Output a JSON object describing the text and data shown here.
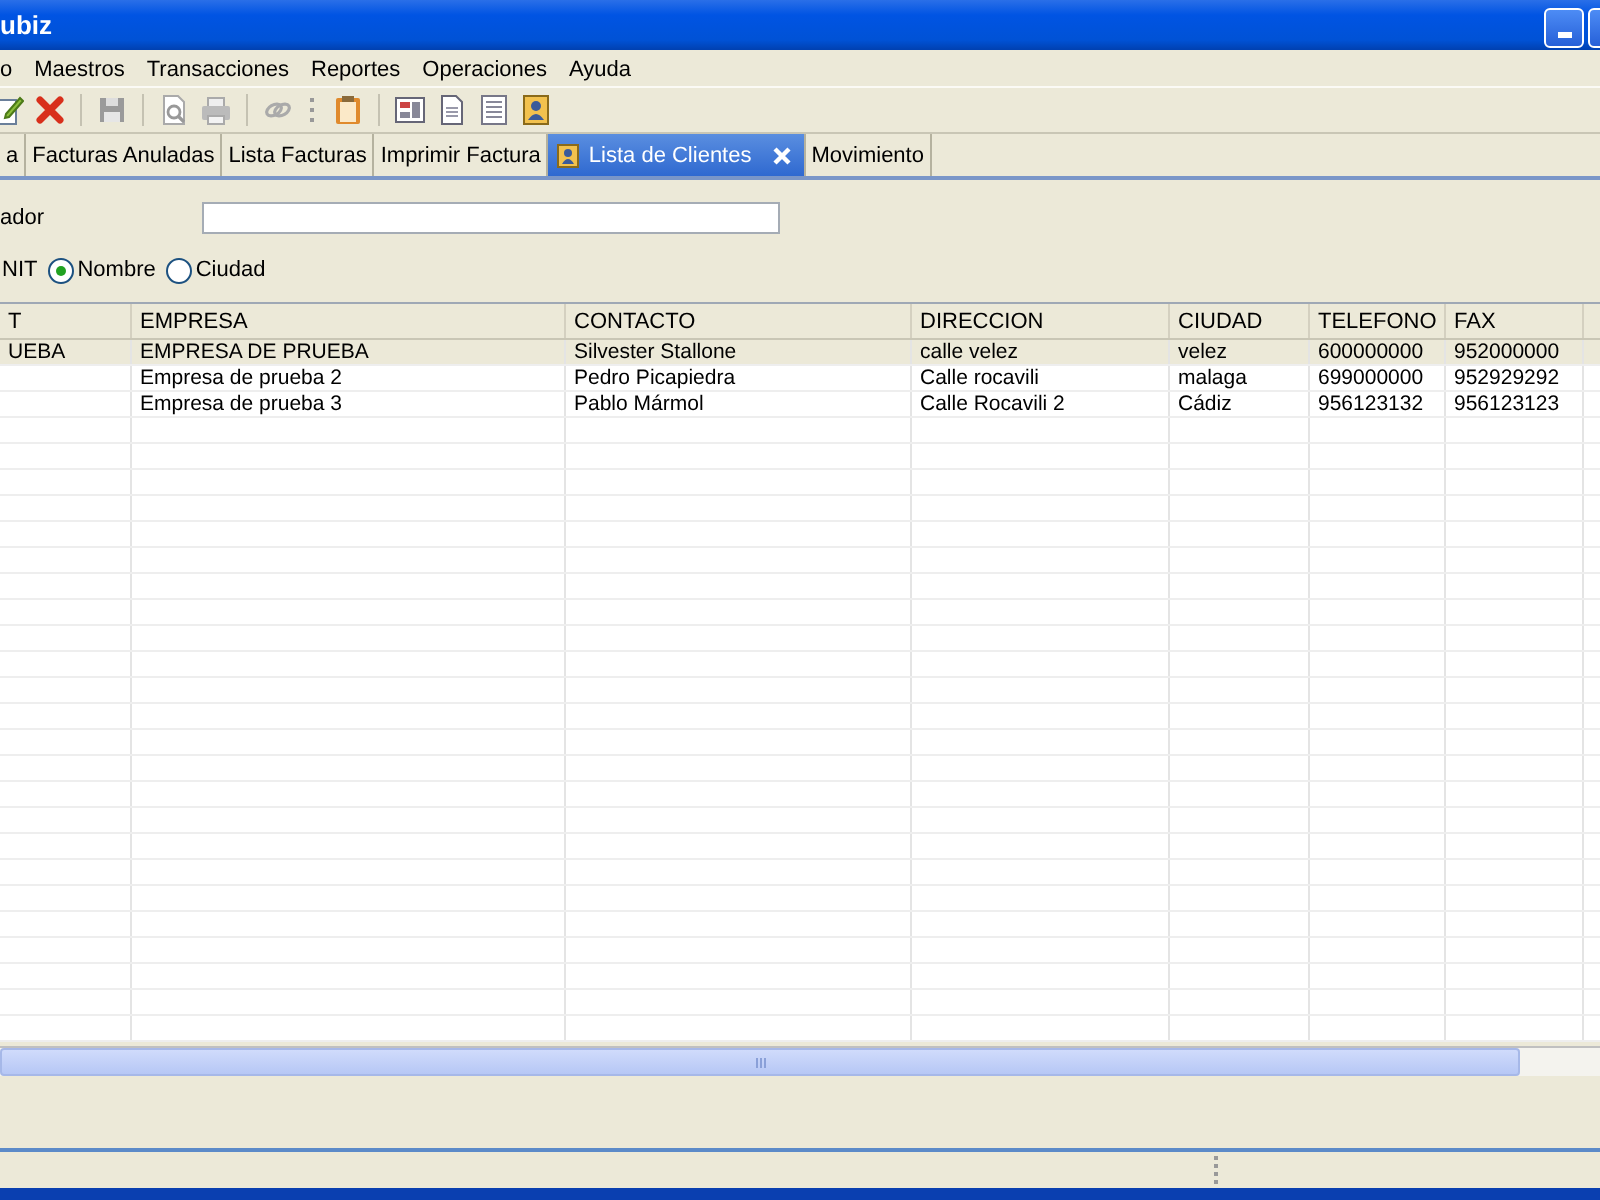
{
  "window": {
    "title": "ubiz"
  },
  "menu": [
    "o",
    "Maestros",
    "Transacciones",
    "Reportes",
    "Operaciones",
    "Ayuda"
  ],
  "toolbar": [
    {
      "kind": "edit"
    },
    {
      "kind": "delete"
    },
    {
      "kind": "sep"
    },
    {
      "kind": "save"
    },
    {
      "kind": "sep"
    },
    {
      "kind": "preview"
    },
    {
      "kind": "print"
    },
    {
      "kind": "sep"
    },
    {
      "kind": "link"
    },
    {
      "kind": "dots"
    },
    {
      "kind": "clipboard"
    },
    {
      "kind": "sep"
    },
    {
      "kind": "form"
    },
    {
      "kind": "page"
    },
    {
      "kind": "list"
    },
    {
      "kind": "person"
    }
  ],
  "tabs": [
    {
      "label": "a",
      "selected": false
    },
    {
      "label": "Facturas Anuladas",
      "selected": false
    },
    {
      "label": "Lista Facturas",
      "selected": false
    },
    {
      "label": "Imprimir Factura",
      "selected": false
    },
    {
      "label": "Lista de Clientes",
      "selected": true
    },
    {
      "label": "Movimiento",
      "selected": false
    }
  ],
  "search": {
    "label": "ador"
  },
  "radio_cut_label": "NIT",
  "radios": [
    {
      "label": "Nombre",
      "selected": true
    },
    {
      "label": "Ciudad",
      "selected": false
    }
  ],
  "table": {
    "columns": [
      "T",
      "EMPRESA",
      "CONTACTO",
      "DIRECCION",
      "CIUDAD",
      "TELEFONO",
      "FAX"
    ],
    "rows": [
      {
        "selected": true,
        "cells": [
          "UEBA",
          "EMPRESA DE PRUEBA",
          "Silvester Stallone",
          "calle velez",
          "velez",
          "600000000",
          "952000000"
        ]
      },
      {
        "selected": false,
        "cells": [
          "",
          "Empresa de prueba 2",
          "Pedro Picapiedra",
          "Calle rocavili",
          "malaga",
          "699000000",
          "952929292"
        ]
      },
      {
        "selected": false,
        "cells": [
          "",
          "Empresa de prueba 3",
          "Pablo Mármol",
          "Calle Rocavili 2",
          "Cádiz",
          "956123132",
          "956123123"
        ]
      }
    ]
  }
}
